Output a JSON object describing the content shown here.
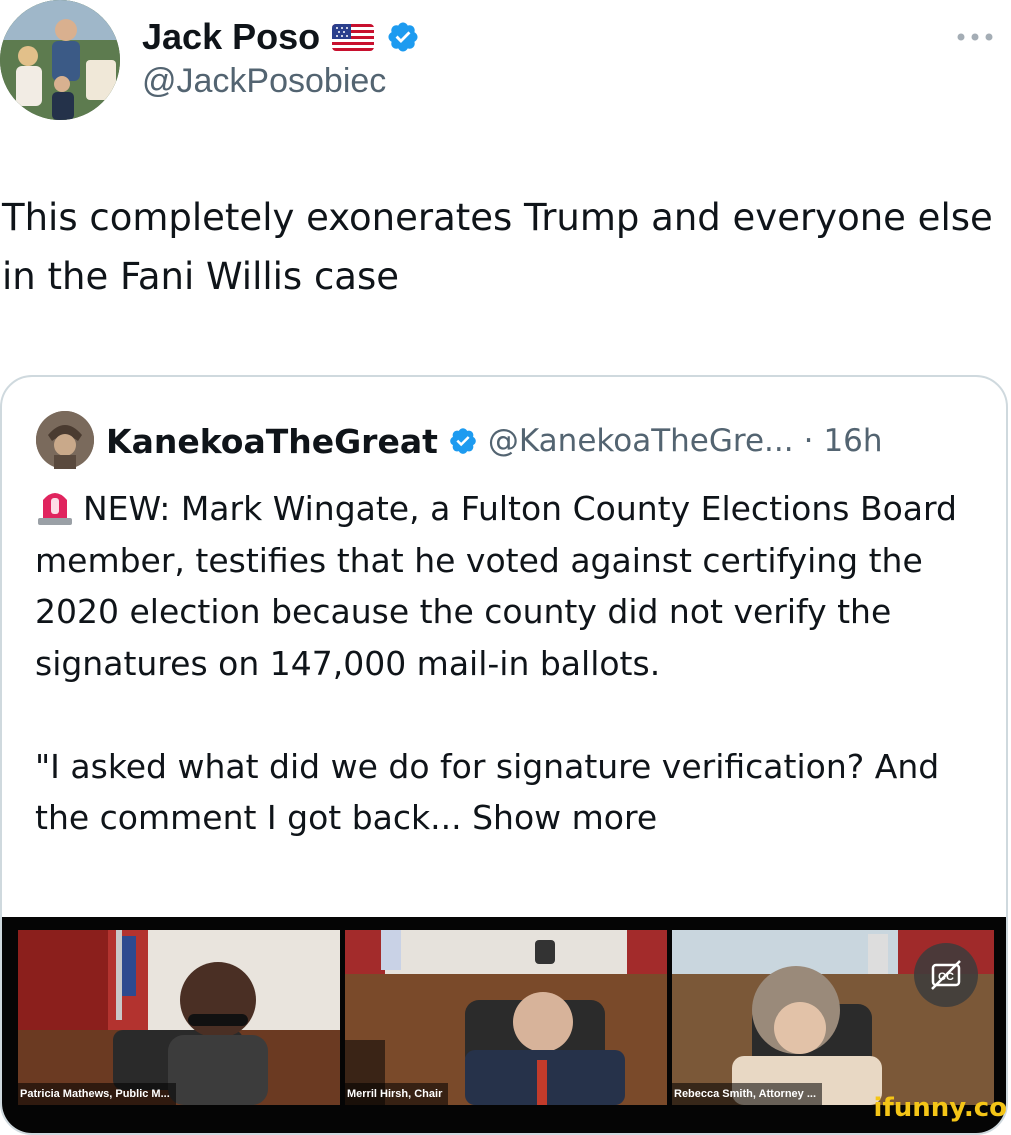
{
  "author": {
    "name": "Jack Poso",
    "handle": "@JackPosobiec",
    "flag_icon": "us-flag-icon",
    "verified_icon": "verified-badge-icon"
  },
  "tweet": {
    "text": "This completely exonerates Trump and everyone else in the Fani Willis case"
  },
  "quoted_tweet": {
    "author_name": "KanekoaTheGreat",
    "author_handle": "@KanekoaTheGre...",
    "separator": "·",
    "time": "16h",
    "text_p1": "NEW: Mark Wingate, a Fulton County Elections Board member, testifies that he voted against certifying the 2020 election because the county did not verify the signatures on 147,000 mail-in ballots.",
    "text_p2": "\"I asked what did we do for signature verification? And the comment I got back...",
    "show_more": "Show more",
    "siren_icon": "police-siren-icon"
  },
  "media": {
    "captions": [
      "Patricia Mathews, Public M...",
      "Merril Hirsh, Chair",
      "Rebecca Smith, Attorney ..."
    ],
    "cc_icon": "closed-captions-icon"
  },
  "watermark": "ifunny.co",
  "colors": {
    "text": "#0f1419",
    "secondary": "#536471",
    "verified": "#1d9bf0",
    "border": "#cfd9de",
    "watermark": "#f4c517"
  }
}
